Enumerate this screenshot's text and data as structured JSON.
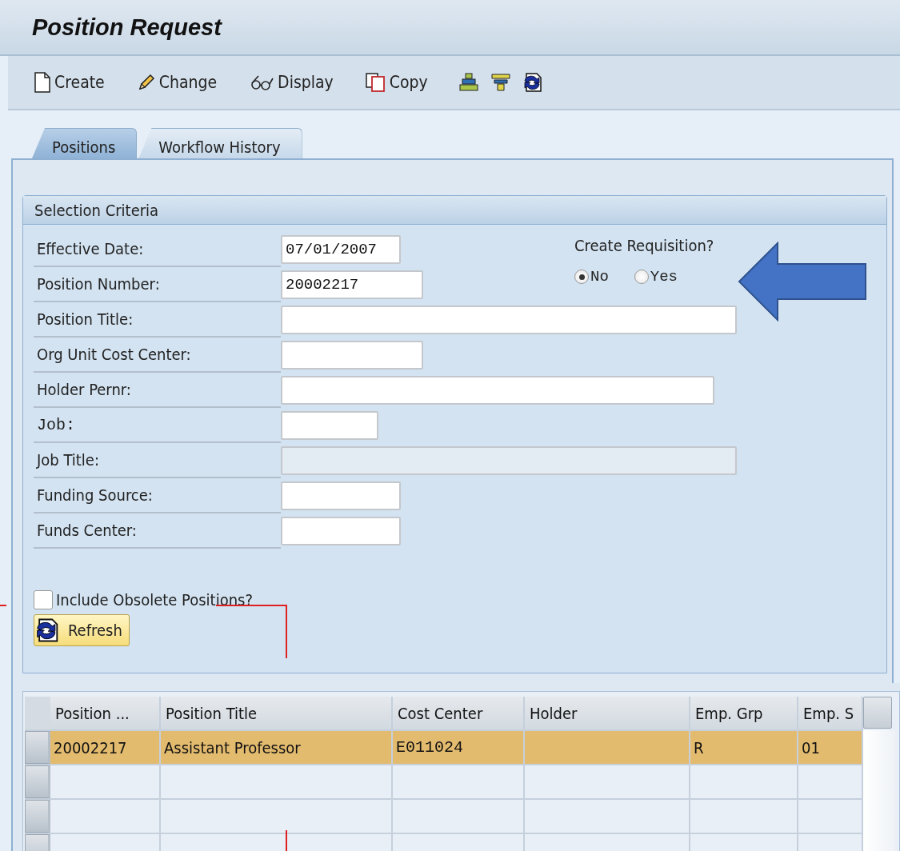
{
  "window": {
    "title": "Position Request"
  },
  "toolbar": [
    {
      "label": "Create"
    },
    {
      "label": "Change"
    },
    {
      "label": "Display"
    },
    {
      "label": "Copy"
    }
  ],
  "tabs": [
    {
      "label": "Positions",
      "selected": true
    },
    {
      "label": "Workflow History",
      "selected": false
    }
  ],
  "selection": {
    "title": "Selection Criteria",
    "fields": [
      {
        "label": "Effective Date:",
        "value": "07/01/2007",
        "disabled": false
      },
      {
        "label": "Position Number:",
        "value": "20002217",
        "disabled": false
      },
      {
        "label": "Position Title:",
        "disabled": false
      },
      {
        "label": "Org Unit Cost Center:",
        "disabled": false
      },
      {
        "label": "Holder Pernr:",
        "disabled": false
      },
      {
        "label": "Job:",
        "disabled": false
      },
      {
        "label": "Job Title:",
        "disabled": true
      },
      {
        "label": "Funding Source:",
        "disabled": false
      },
      {
        "label": "Funds Center:",
        "disabled": false
      }
    ],
    "requisition": {
      "label": "Create Requisition?",
      "options": [
        {
          "label": "No",
          "selected": true
        },
        {
          "label": "Yes",
          "selected": false
        }
      ]
    },
    "obsolete": {
      "label": "Include Obsolete Positions?",
      "checked": false
    },
    "refresh_button": "Refresh"
  },
  "table": {
    "columns": [
      "Position ...",
      "Position Title",
      "Cost Center",
      "Holder",
      "Emp. Grp",
      "Emp. S"
    ],
    "rows": [
      {
        "cells": [
          "20002217",
          "Assistant Professor",
          "E011024",
          "",
          "R",
          "01"
        ],
        "selected": true
      }
    ]
  }
}
